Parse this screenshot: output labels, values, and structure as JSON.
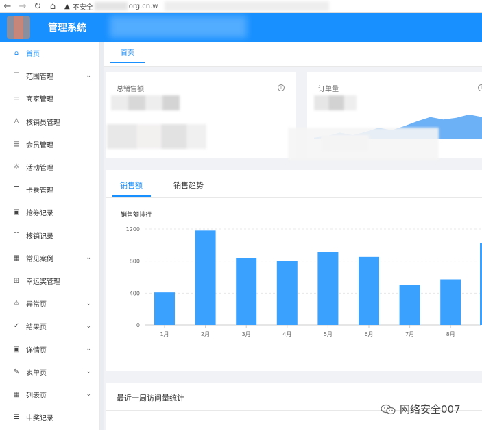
{
  "browser": {
    "address_prefix": "不安全",
    "address_suffix": "org.cn.w"
  },
  "app": {
    "title": "管理系统"
  },
  "sidebar": {
    "items": [
      {
        "label": "首页",
        "icon": "home-icon",
        "glyph": "⌂",
        "active": true,
        "has_children": false
      },
      {
        "label": "范围管理",
        "icon": "list-icon",
        "glyph": "☰",
        "active": false,
        "has_children": true
      },
      {
        "label": "商家管理",
        "icon": "calendar-icon",
        "glyph": "▭",
        "active": false,
        "has_children": false
      },
      {
        "label": "核销员管理",
        "icon": "user-icon",
        "glyph": "♙",
        "active": false,
        "has_children": false
      },
      {
        "label": "会员管理",
        "icon": "id-card-icon",
        "glyph": "▤",
        "active": false,
        "has_children": false
      },
      {
        "label": "活动管理",
        "icon": "bulb-icon",
        "glyph": "☼",
        "active": false,
        "has_children": false
      },
      {
        "label": "卡卷管理",
        "icon": "copy-icon",
        "glyph": "❐",
        "active": false,
        "has_children": false
      },
      {
        "label": "抢券记录",
        "icon": "file-icon",
        "glyph": "▣",
        "active": false,
        "has_children": false
      },
      {
        "label": "核销记录",
        "icon": "ordered-list-icon",
        "glyph": "☷",
        "active": false,
        "has_children": false
      },
      {
        "label": "常见案例",
        "icon": "appstore-icon",
        "glyph": "▦",
        "active": false,
        "has_children": true
      },
      {
        "label": "幸运奖管理",
        "icon": "gift-icon",
        "glyph": "⊞",
        "active": false,
        "has_children": false
      },
      {
        "label": "异常页",
        "icon": "warning-icon",
        "glyph": "⚠",
        "active": false,
        "has_children": true
      },
      {
        "label": "结果页",
        "icon": "check-circle-icon",
        "glyph": "✓",
        "active": false,
        "has_children": true
      },
      {
        "label": "详情页",
        "icon": "profile-icon",
        "glyph": "▣",
        "active": false,
        "has_children": true
      },
      {
        "label": "表单页",
        "icon": "form-icon",
        "glyph": "✎",
        "active": false,
        "has_children": true
      },
      {
        "label": "列表页",
        "icon": "table-icon",
        "glyph": "▦",
        "active": false,
        "has_children": true
      },
      {
        "label": "中奖记录",
        "icon": "bars-icon",
        "glyph": "☰",
        "active": false,
        "has_children": false
      }
    ]
  },
  "tabs": {
    "home": "首页"
  },
  "stats": {
    "total_sales": {
      "title": "总销售额",
      "info_icon": "info-circle-icon"
    },
    "orders": {
      "title": "订单量",
      "info_icon": "info-circle-icon"
    }
  },
  "sales_card": {
    "tabs": [
      "销售额",
      "销售趋势"
    ],
    "active_tab": 0,
    "chart_title": "销售额排行"
  },
  "chart_data": {
    "type": "bar",
    "title": "销售额排行",
    "categories": [
      "1月",
      "2月",
      "3月",
      "4月",
      "5月",
      "6月",
      "7月",
      "8月"
    ],
    "values": [
      410,
      1180,
      840,
      805,
      910,
      850,
      500,
      570
    ],
    "y_ticks": [
      "0",
      "400",
      "800",
      "1200"
    ],
    "ylim": [
      0,
      1200
    ],
    "color": "#3aa1ff",
    "grid": true,
    "legend": "none"
  },
  "area_chart": {
    "type": "area",
    "values": [
      2,
      4,
      8,
      5,
      9,
      14,
      11,
      16,
      22,
      27,
      24,
      26,
      30,
      27
    ],
    "color": "#6cb0f5"
  },
  "weekly_card": {
    "title": "最近一周访问量统计"
  },
  "watermark": {
    "text": "网络安全007",
    "icon": "wechat-icon"
  },
  "colors": {
    "primary": "#1890ff",
    "bar": "#3aa1ff"
  }
}
